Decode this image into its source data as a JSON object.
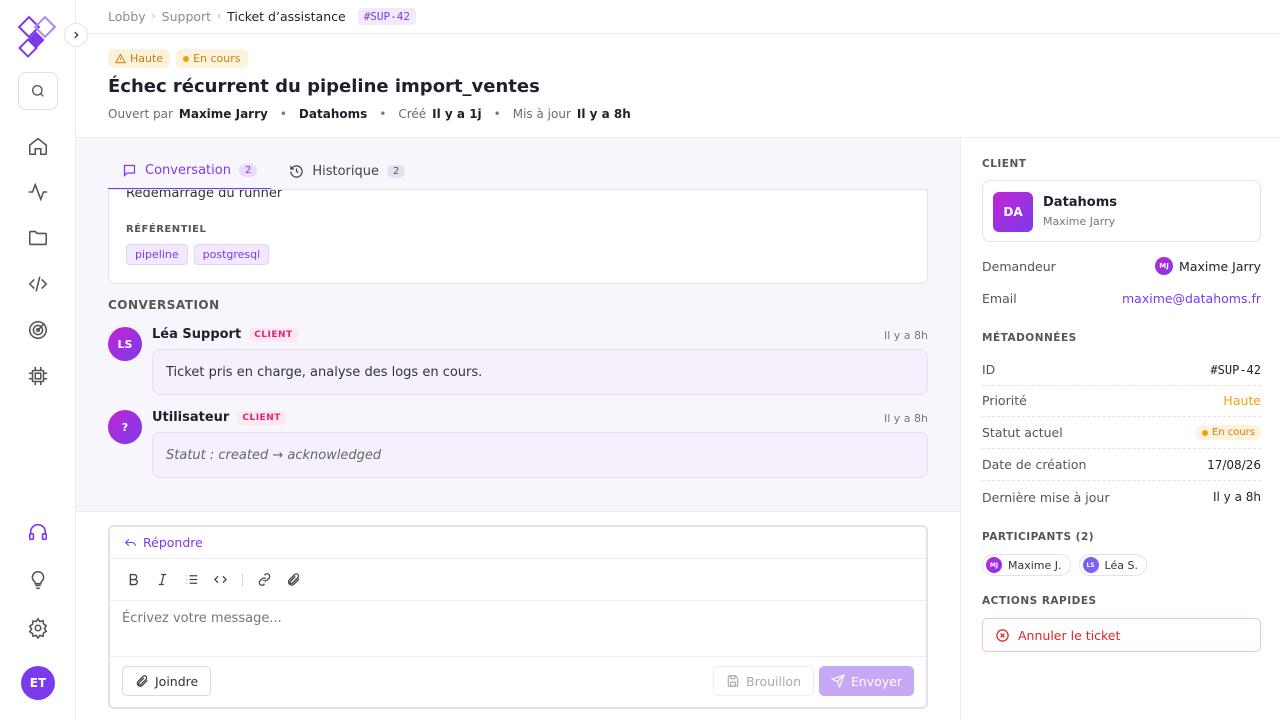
{
  "breadcrumb": {
    "items": [
      "Lobby",
      "Support",
      "Ticket d’assistance"
    ],
    "ticket_tag": "#SUP-42"
  },
  "ticket": {
    "priority": "Haute",
    "status": "En cours",
    "title": "Échec récurrent du pipeline import_ventes",
    "meta": {
      "opened_by_label": "Ouvert par",
      "opened_by": "Maxime Jarry",
      "company": "Datahoms",
      "created_label": "Créé",
      "created": "Il y a 1j",
      "updated_label": "Mis à jour",
      "updated": "Il y a 8h"
    }
  },
  "tabs": [
    {
      "label": "Conversation",
      "count": "2"
    },
    {
      "label": "Historique",
      "count": "2"
    }
  ],
  "ref_card": {
    "text": "Redémarrage du runner",
    "label": "RÉFÉRENTIEL",
    "tags": [
      "pipeline",
      "postgresql"
    ]
  },
  "conversation": {
    "label": "CONVERSATION",
    "messages": [
      {
        "initials": "LS",
        "author": "Léa Support",
        "role": "CLIENT",
        "time": "Il y a 8h",
        "text": "Ticket pris en charge, analyse des logs en cours."
      },
      {
        "initials": "?",
        "author": "Utilisateur",
        "role": "CLIENT",
        "time": "Il y a 8h",
        "text": "Statut : created → acknowledged"
      }
    ]
  },
  "composer": {
    "reply_label": "Répondre",
    "placeholder": "Écrivez votre message...",
    "attach_label": "Joindre",
    "draft_label": "Brouillon",
    "send_label": "Envoyer"
  },
  "sidebar": {
    "client_label": "CLIENT",
    "client": {
      "initials": "DA",
      "name": "Datahoms",
      "contact": "Maxime Jarry"
    },
    "requester_label": "Demandeur",
    "requester_initials": "MJ",
    "requester": "Maxime Jarry",
    "email_label": "Email",
    "email": "maxime@datahoms.fr",
    "metadata_label": "MÉTADONNÉES",
    "metadata": [
      {
        "label": "ID",
        "value": "#SUP-42"
      },
      {
        "label": "Priorité",
        "value": "Haute"
      },
      {
        "label": "Statut actuel",
        "value": "En cours"
      },
      {
        "label": "Date de création",
        "value": "17/08/26"
      },
      {
        "label": "Dernière mise à jour",
        "value": "Il y a 8h"
      }
    ],
    "participants_label": "PARTICIPANTS (2)",
    "participants": [
      {
        "initials": "MJ",
        "name": "Maxime J."
      },
      {
        "initials": "LS",
        "name": "Léa S."
      }
    ],
    "quick_actions_label": "ACTIONS RAPIDES",
    "cancel_label": "Annuler le ticket"
  },
  "user": {
    "initials": "ET"
  },
  "colors": {
    "accent": "#7c3aed",
    "warning": "#f59e0b",
    "danger": "#dc2626",
    "pink": "#db2777"
  }
}
